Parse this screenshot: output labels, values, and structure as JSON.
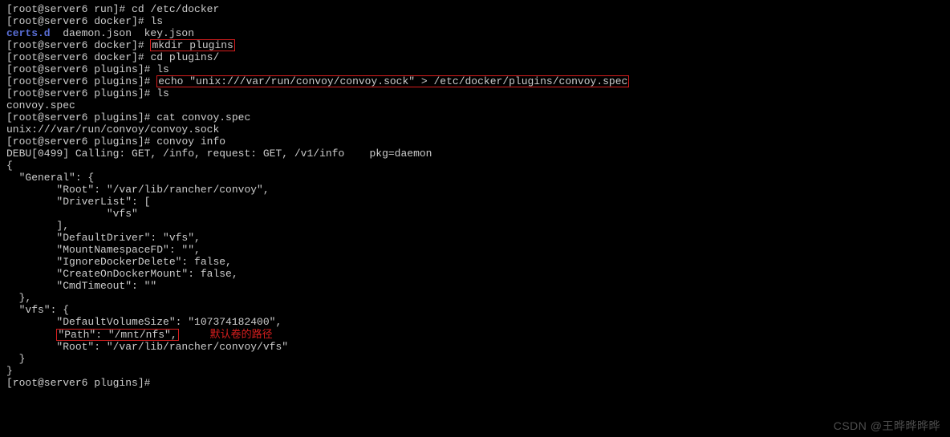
{
  "prompts": {
    "run": "[root@server6 run]# ",
    "docker": "[root@server6 docker]# ",
    "plugins": "[root@server6 plugins]# "
  },
  "cmds": {
    "cd_docker": "cd /etc/docker",
    "ls": "ls",
    "mkdir_plugins": "mkdir plugins",
    "cd_plugins": "cd plugins/",
    "echo_spec": "echo \"unix:///var/run/convoy/convoy.sock\" > /etc/docker/plugins/convoy.spec",
    "cat_spec": "cat convoy.spec",
    "convoy_info": "convoy info"
  },
  "ls_out": {
    "certs": "certs.d",
    "rest": "  daemon.json  key.json"
  },
  "spec_file": "convoy.spec",
  "cat_out": "unix:///var/run/convoy/convoy.sock",
  "debu": "DEBU[0499] Calling: GET, /info, request: GET, /v1/info    pkg=daemon",
  "json_lines": {
    "open": "{",
    "gen_open": "  \"General\": {",
    "root": "        \"Root\": \"/var/lib/rancher/convoy\",",
    "dl_open": "        \"DriverList\": [",
    "dl_vfs": "                \"vfs\"",
    "dl_close": "        ],",
    "def_drv": "        \"DefaultDriver\": \"vfs\",",
    "mnt_ns": "        \"MountNamespaceFD\": \"\",",
    "ign_del": "        \"IgnoreDockerDelete\": false,",
    "create_mnt": "        \"CreateOnDockerMount\": false,",
    "cmd_to": "        \"CmdTimeout\": \"\"",
    "gen_close": "  },",
    "vfs_open": "  \"vfs\": {",
    "vfs_dvs": "        \"DefaultVolumeSize\": \"107374182400\",",
    "vfs_path_pad": "        ",
    "vfs_path": "\"Path\": \"/mnt/nfs\",",
    "vfs_root": "        \"Root\": \"/var/lib/rancher/convoy/vfs\"",
    "vfs_close": "  }",
    "close": "}"
  },
  "annotation": "默认卷的路径",
  "watermark": "CSDN @王晔晔晔晔"
}
